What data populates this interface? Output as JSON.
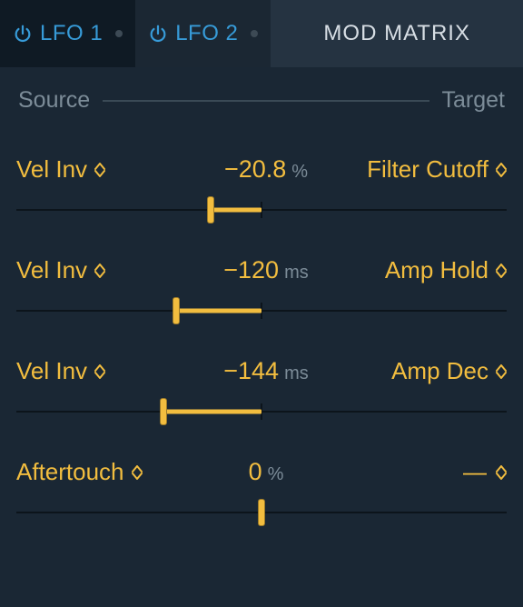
{
  "tabs": {
    "lfo1": "LFO 1",
    "lfo2": "LFO 2",
    "modmatrix": "MOD MATRIX"
  },
  "header": {
    "source": "Source",
    "target": "Target"
  },
  "rows": [
    {
      "source": "Vel Inv",
      "value": "−20.8",
      "unit": "%",
      "target": "Filter Cutoff",
      "thumb_pct": 39.6,
      "fill_from": 39.6,
      "fill_to": 50
    },
    {
      "source": "Vel Inv",
      "value": "−120",
      "unit": "ms",
      "target": "Amp Hold",
      "thumb_pct": 32.5,
      "fill_from": 32.5,
      "fill_to": 50
    },
    {
      "source": "Vel Inv",
      "value": "−144",
      "unit": "ms",
      "target": "Amp Dec",
      "thumb_pct": 30.0,
      "fill_from": 30.0,
      "fill_to": 50
    },
    {
      "source": "Aftertouch",
      "value": "0",
      "unit": "%",
      "target": "—",
      "thumb_pct": 50.0,
      "fill_from": 50,
      "fill_to": 50
    }
  ],
  "colors": {
    "accent": "#f2bd3f",
    "blue": "#379bd8",
    "muted": "#7c8c98"
  }
}
